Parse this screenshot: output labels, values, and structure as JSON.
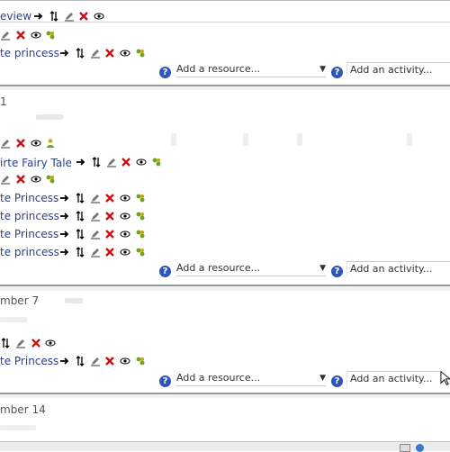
{
  "rows": {
    "r0": "eview",
    "r1": "te princess",
    "sec_num": "1",
    "r2": "irte Fairy Tale",
    "r3": "te Princess",
    "r4": "te princess",
    "r5": "te Princess",
    "r6": "te princess",
    "sec3_title": "mber 7",
    "r7": "te Princess",
    "sec4_title": "mber 14"
  },
  "controls": {
    "add_resource": "Add a resource...",
    "add_activity": "Add an activity...",
    "help_glyph": "?",
    "dropdown_arrow": "▼"
  },
  "icon_names": [
    "arrow-right-icon",
    "move-updown-icon",
    "edit-icon",
    "delete-icon",
    "eye-icon",
    "group-icon"
  ],
  "colors": {
    "link": "#2b3f8f",
    "help": "#2d56b6",
    "delete": "#cc1111",
    "group": "#6aa51a"
  }
}
